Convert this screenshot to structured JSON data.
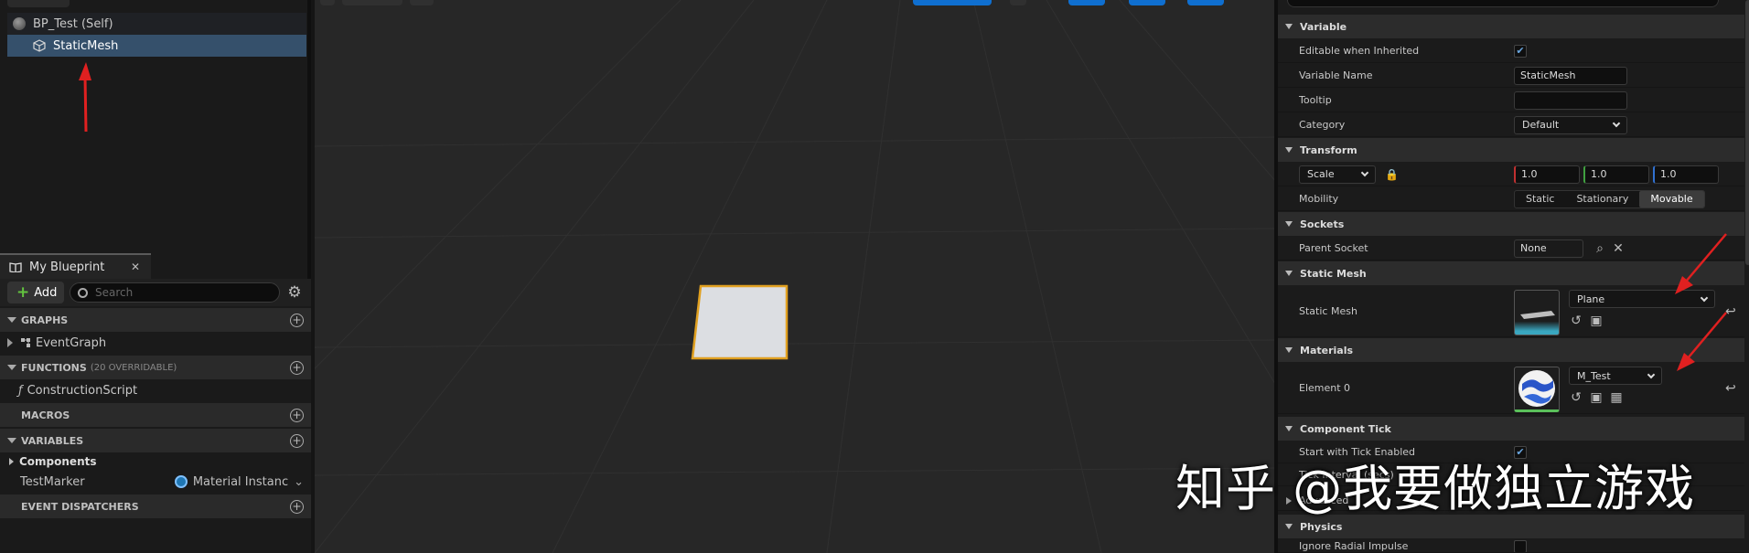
{
  "components": {
    "self": "BP_Test (Self)",
    "selected": "StaticMesh"
  },
  "my_blueprint": {
    "tab_label": "My Blueprint",
    "close": "✕",
    "add_label": "Add",
    "search_placeholder": "Search",
    "sections": {
      "graphs": "GRAPHS",
      "functions": "FUNCTIONS",
      "functions_sub": "(20 OVERRIDABLE)",
      "macros": "MACROS",
      "variables": "VARIABLES",
      "dispatchers": "EVENT DISPATCHERS"
    },
    "graph_items": [
      "EventGraph"
    ],
    "function_items": [
      "ConstructionScript"
    ],
    "components_group": "Components",
    "variables": [
      {
        "name": "TestMarker",
        "type": "Material Instanc"
      }
    ]
  },
  "details": {
    "categories": {
      "variable": "Variable",
      "transform": "Transform",
      "sockets": "Sockets",
      "static_mesh": "Static Mesh",
      "materials": "Materials",
      "component_tick": "Component Tick",
      "advanced": "Advanced",
      "physics": "Physics"
    },
    "editable_when_inherited": "Editable when Inherited",
    "variable_name_label": "Variable Name",
    "variable_name_value": "StaticMesh",
    "tooltip_label": "Tooltip",
    "category_label": "Category",
    "category_value": "Default",
    "scale_label": "Scale",
    "scale": [
      "1.0",
      "1.0",
      "1.0"
    ],
    "mobility_label": "Mobility",
    "mobility_options": [
      "Static",
      "Stationary",
      "Movable"
    ],
    "parent_socket_label": "Parent Socket",
    "parent_socket_value": "None",
    "static_mesh_label": "Static Mesh",
    "static_mesh_value": "Plane",
    "element0_label": "Element 0",
    "element0_value": "M_Test",
    "start_tick_label": "Start with Tick Enabled",
    "tick_interval_label": "Tick Interval (secs)",
    "ignore_radial_label": "Ignore Radial Impulse"
  },
  "watermark": "知乎 @我要做独立游戏",
  "colors": {
    "selection": "#35506b",
    "accent_blue": "#0f6fd0",
    "outline_orange": "#e0a020",
    "annotation_red": "#e02020"
  }
}
